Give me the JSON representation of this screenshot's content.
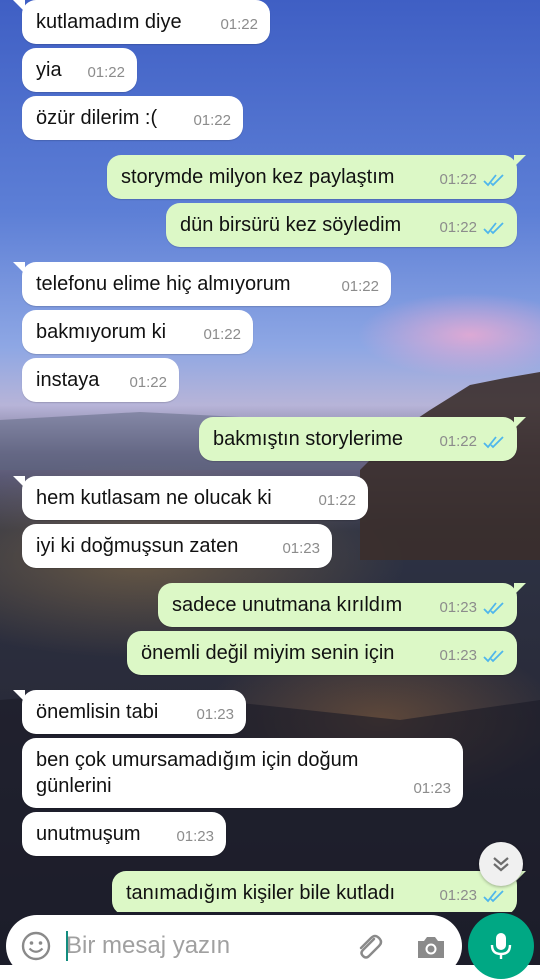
{
  "messages": [
    {
      "direction": "in",
      "text": "kutlamadım diye",
      "time": "01:22"
    },
    {
      "direction": "in",
      "text": "yia",
      "time": "01:22"
    },
    {
      "direction": "in",
      "text": "özür dilerim :(",
      "time": "01:22"
    },
    {
      "direction": "out",
      "text": "storymde milyon kez paylaştım",
      "time": "01:22"
    },
    {
      "direction": "out",
      "text": "dün birsürü kez söyledim",
      "time": "01:22"
    },
    {
      "direction": "in",
      "text": "telefonu elime hiç almıyorum",
      "time": "01:22"
    },
    {
      "direction": "in",
      "text": "bakmıyorum ki",
      "time": "01:22"
    },
    {
      "direction": "in",
      "text": "instaya",
      "time": "01:22"
    },
    {
      "direction": "out",
      "text": "bakmıştın storylerime",
      "time": "01:22"
    },
    {
      "direction": "in",
      "text": "hem kutlasam ne olucak ki",
      "time": "01:22"
    },
    {
      "direction": "in",
      "text": "iyi ki doğmuşsun zaten",
      "time": "01:23"
    },
    {
      "direction": "out",
      "text": "sadece unutmana kırıldım",
      "time": "01:23"
    },
    {
      "direction": "out",
      "text": "önemli değil miyim senin için",
      "time": "01:23"
    },
    {
      "direction": "in",
      "text": "önemlisin tabi",
      "time": "01:23"
    },
    {
      "direction": "in",
      "text": "ben çok umursamadığım için doğum\ngünlerini",
      "time": "01:23"
    },
    {
      "direction": "in",
      "text": "unutmuşum",
      "time": "01:23"
    },
    {
      "direction": "out",
      "text": "tanımadığım kişiler bile kutladı",
      "time": "01:23"
    }
  ],
  "composer": {
    "placeholder": "Bir mesaj yazın",
    "value": ""
  },
  "icons": {
    "emoji": "emoji-icon",
    "attach": "paperclip-icon",
    "camera": "camera-icon",
    "mic": "microphone-icon",
    "scroll": "chevron-double-down-icon",
    "read_receipt": "double-check-icon"
  },
  "colors": {
    "incoming_bubble": "#ffffff",
    "outgoing_bubble": "#dcf8c6",
    "read_tick": "#4fb6ec",
    "accent": "#00a884",
    "caret": "#128c7e"
  }
}
